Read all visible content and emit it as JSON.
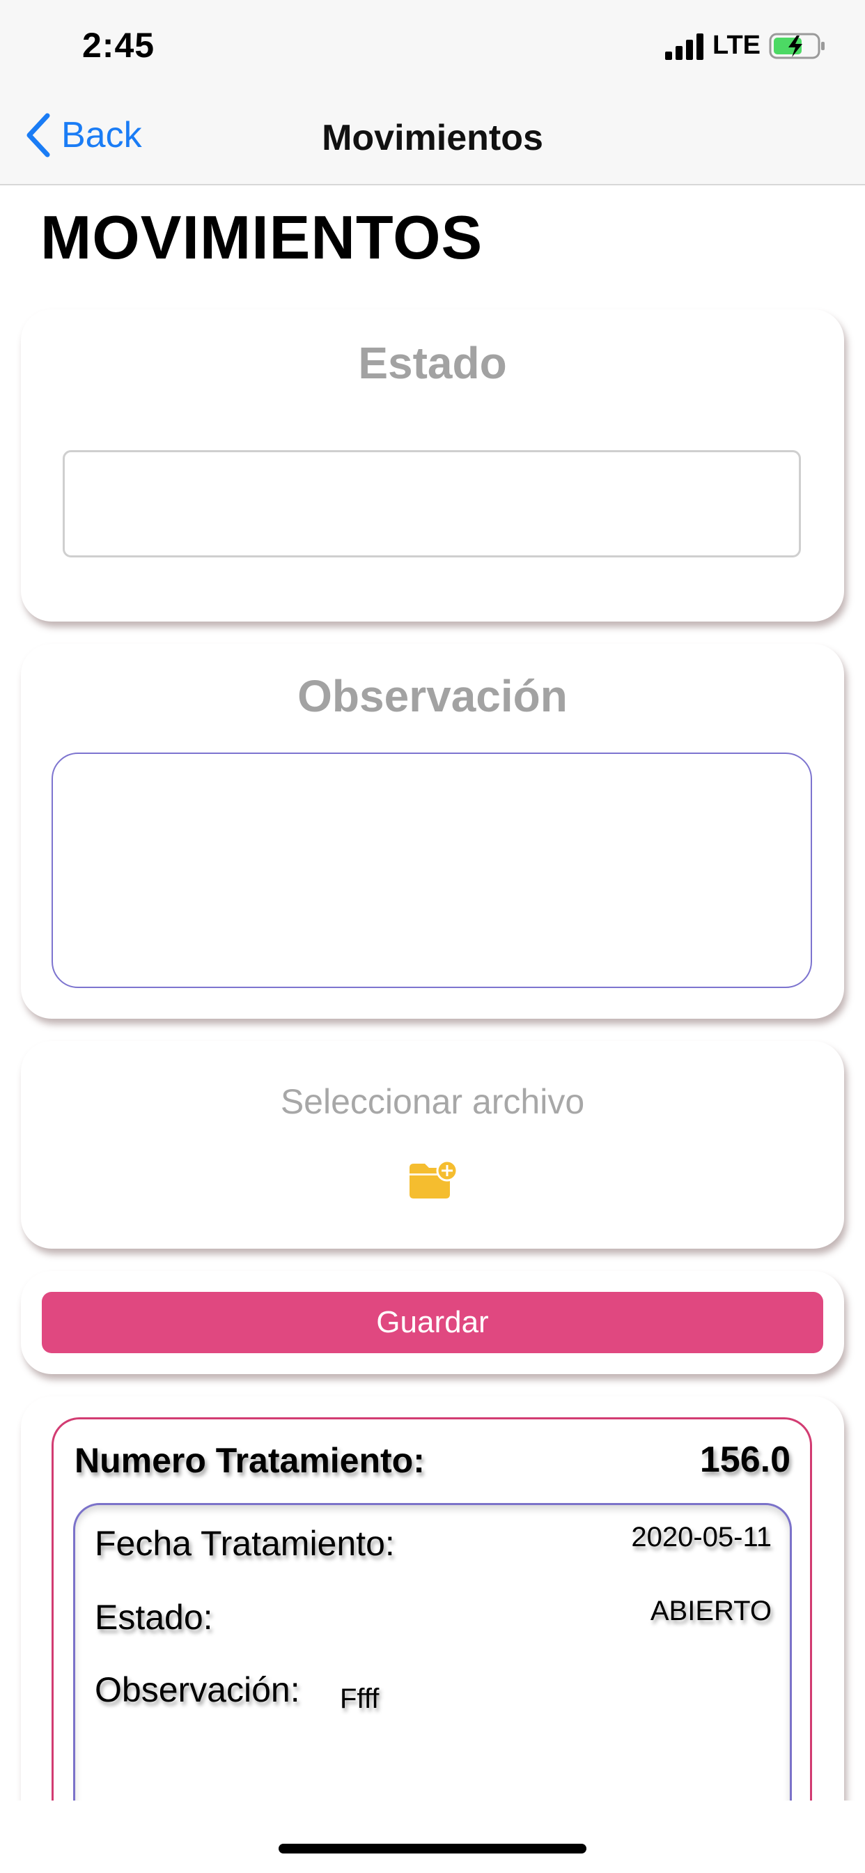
{
  "status_bar": {
    "time": "2:45",
    "network": "LTE",
    "battery_color": "#4cd964"
  },
  "nav": {
    "back_label": "Back",
    "title": "Movimientos"
  },
  "page": {
    "heading": "MOVIMIENTOS"
  },
  "estado_card": {
    "title": "Estado",
    "input_value": ""
  },
  "observacion_card": {
    "title": "Observación",
    "textarea_value": ""
  },
  "file_card": {
    "label": "Seleccionar archivo",
    "icon": "folder-add-icon",
    "icon_color": "#f5bd2f"
  },
  "save": {
    "label": "Guardar",
    "color": "#e04880"
  },
  "treatment": {
    "numero_label": "Numero Tratamiento:",
    "numero_value": "156.0",
    "fecha_label": "Fecha Tratamiento:",
    "fecha_value": "2020-05-11",
    "estado_label": "Estado:",
    "estado_value": "ABIERTO",
    "observacion_label": "Observación:",
    "observacion_value": "Ffff"
  }
}
